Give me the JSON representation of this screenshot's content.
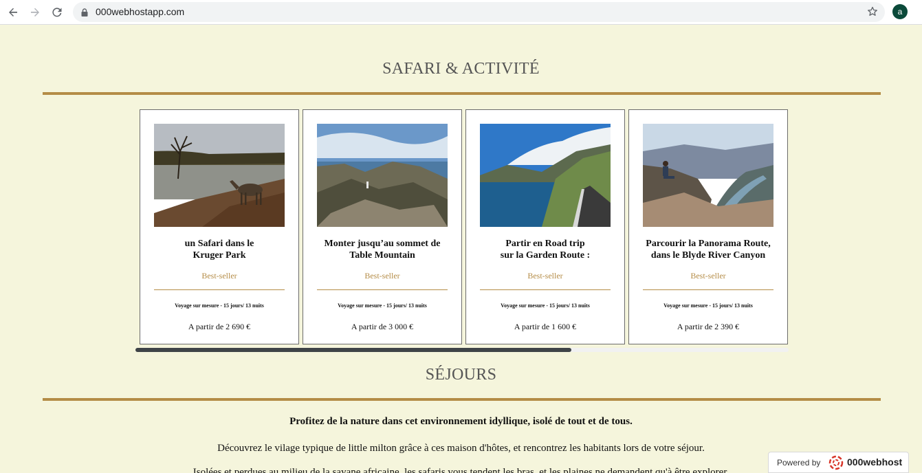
{
  "browser": {
    "url": "000webhostapp.com",
    "profile_initial": "a",
    "icons": [
      "back-arrow-icon",
      "forward-arrow-icon",
      "reload-icon",
      "lock-icon",
      "star-icon"
    ]
  },
  "safari_section": {
    "title": "SAFARI & ACTIVITÉ",
    "cards": [
      {
        "title_line1": "un Safari dans le",
        "title_line2": "Kruger Park",
        "badge": "Best-seller",
        "meta": "Voyage sur mesure - 15 jours/ 13 nuits",
        "price": "A partir de 2 690 €"
      },
      {
        "title_line1": "Monter jusqu’au sommet de",
        "title_line2": "Table Mountain",
        "badge": "Best-seller",
        "meta": "Voyage sur mesure - 15 jours/ 13 nuits",
        "price": "A partir de 3 000 €"
      },
      {
        "title_line1": "Partir en Road trip",
        "title_line2": "sur la Garden Route :",
        "badge": "Best-seller",
        "meta": "Voyage sur mesure - 15 jours/ 13 nuits",
        "price": "A partir de 1 600 €"
      },
      {
        "title_line1": "Parcourir la Panorama Route,",
        "title_line2": "dans le Blyde River Canyon",
        "badge": "Best-seller",
        "meta": "Voyage sur mesure - 15 jours/ 13 nuits",
        "price": "A partir de 2 390 €"
      }
    ],
    "scroll_position": 0.67
  },
  "sejours_section": {
    "title": "SÉJOURS",
    "intro_bold": "Profitez de la nature dans cet environnement idyllique, isolé de tout et de tous.",
    "intro_1": "Découvrez le vilage typique de little milton grâce à ces maison d'hôtes, et rencontrez les habitants lors de votre séjour.",
    "intro_2": "Isolées et perdues au milieu de la savane africaine, les safaris vous tendent les bras, et les plaines ne demandent qu'à être explorer."
  },
  "badge_powered": {
    "label": "Powered by",
    "brand": "000webhost"
  },
  "colors": {
    "page_background": "#f5f5dc",
    "accent": "#b48c46"
  }
}
